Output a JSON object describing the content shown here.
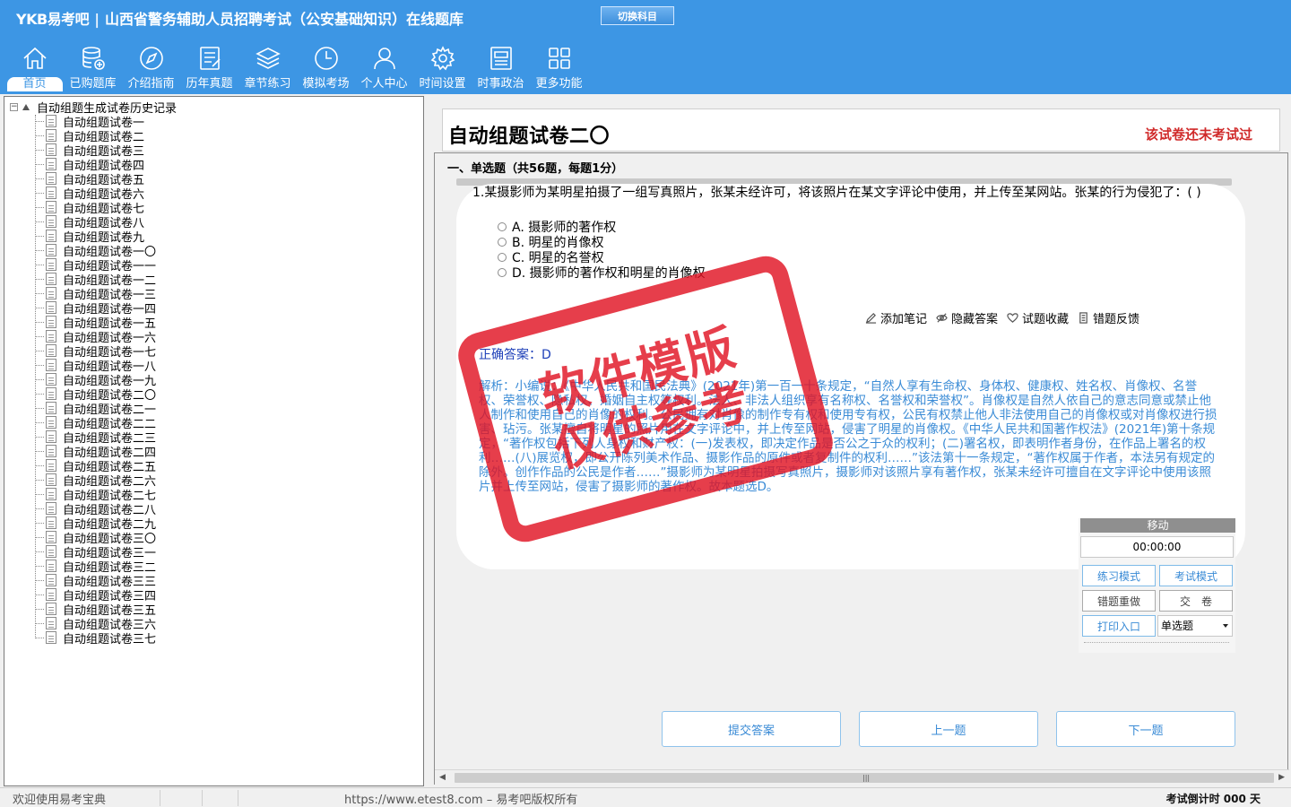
{
  "header": {
    "logo": "YKB易考吧",
    "title": "山西省警务辅助人员招聘考试（公安基础知识）在线题库",
    "switch_label": "切换科目",
    "toolbar": [
      {
        "label": "首页",
        "icon": "home-icon"
      },
      {
        "label": "已购题库",
        "icon": "database-icon"
      },
      {
        "label": "介绍指南",
        "icon": "compass-icon"
      },
      {
        "label": "历年真题",
        "icon": "document-list-icon"
      },
      {
        "label": "章节练习",
        "icon": "layers-icon"
      },
      {
        "label": "模拟考场",
        "icon": "clock-icon"
      },
      {
        "label": "个人中心",
        "icon": "user-icon"
      },
      {
        "label": "时间设置",
        "icon": "gear-icon"
      },
      {
        "label": "时事政治",
        "icon": "news-icon"
      },
      {
        "label": "更多功能",
        "icon": "grid-icon"
      }
    ]
  },
  "tree": {
    "root": "自动组题生成试卷历史记录",
    "items": [
      "自动组题试卷一",
      "自动组题试卷二",
      "自动组题试卷三",
      "自动组题试卷四",
      "自动组题试卷五",
      "自动组题试卷六",
      "自动组题试卷七",
      "自动组题试卷八",
      "自动组题试卷九",
      "自动组题试卷一〇",
      "自动组题试卷一一",
      "自动组题试卷一二",
      "自动组题试卷一三",
      "自动组题试卷一四",
      "自动组题试卷一五",
      "自动组题试卷一六",
      "自动组题试卷一七",
      "自动组题试卷一八",
      "自动组题试卷一九",
      "自动组题试卷二〇",
      "自动组题试卷二一",
      "自动组题试卷二二",
      "自动组题试卷二三",
      "自动组题试卷二四",
      "自动组题试卷二五",
      "自动组题试卷二六",
      "自动组题试卷二七",
      "自动组题试卷二八",
      "自动组题试卷二九",
      "自动组题试卷三〇",
      "自动组题试卷三一",
      "自动组题试卷三二",
      "自动组题试卷三三",
      "自动组题试卷三四",
      "自动组题试卷三五",
      "自动组题试卷三六",
      "自动组题试卷三七"
    ]
  },
  "exam": {
    "title": "自动组题试卷二〇",
    "status": "该试卷还未考试过",
    "section": "一、单选题（共56题，每题1分）",
    "question": "1.某摄影师为某明星拍摄了一组写真照片，张某未经许可，将该照片在某文字评论中使用，并上传至某网站。张某的行为侵犯了：( )",
    "options": [
      "A. 摄影师的著作权",
      "B. 明星的肖像权",
      "C. 明星的名誉权",
      "D. 摄影师的著作权和明星的肖像权"
    ],
    "actions": [
      {
        "label": "添加笔记",
        "icon": "pencil-icon"
      },
      {
        "label": "隐藏答案",
        "icon": "eye-icon"
      },
      {
        "label": "试题收藏",
        "icon": "heart-icon"
      },
      {
        "label": "错题反馈",
        "icon": "feedback-icon"
      }
    ],
    "answer": "正确答案：D",
    "analysis": "解析：小编说：《中华人民共和国民法典》(2021年)第一百一十条规定，“自然人享有生命权、身体权、健康权、姓名权、肖像权、名誉权、荣誉权、隐私权、婚姻自主权等权利。法人、非法人组织享有名称权、名誉权和荣誉权”。肖像权是自然人依自己的意志同意或禁止他人制作和使用自己的肖像的权利。公民拥有对肖像的制作专有权和使用专有权，公民有权禁止他人非法使用自己的肖像权或对肖像权进行损害、玷污。张某擅自将明星的照片用在文字评论中，并上传至网站，侵害了明星的肖像权。《中华人民共和国著作权法》(2021年)第十条规定，“著作权包括下列人身权和财产权：(一)发表权，即决定作品是否公之于众的权利；(二)署名权，即表明作者身份，在作品上署名的权利……(八)展览权，即公开陈列美术作品、摄影作品的原件或者复制件的权利……”该法第十一条规定，“著作权属于作者，本法另有规定的除外。创作作品的公民是作者……”摄影师为某明星拍摄写真照片，摄影师对该照片享有著作权，张某未经许可擅自在文字评论中使用该照片并上传至网站，侵害了摄影师的著作权。故本题选D。"
  },
  "timer": {
    "header": "移动",
    "time": "00:00:00",
    "practice_mode": "练习模式",
    "exam_mode": "考试模式",
    "redo_wrong": "错题重做",
    "submit_paper": "交　卷",
    "print": "打印入口",
    "type_select": "单选题"
  },
  "nav": {
    "submit": "提交答案",
    "prev": "上一题",
    "next": "下一题"
  },
  "watermark": {
    "line1": "软件模版",
    "line2": "仅供参考"
  },
  "statusbar": {
    "welcome": "欢迎使用易考宝典",
    "copyright": "https://www.etest8.com – 易考吧版权所有",
    "countdown": "考试倒计时 000 天"
  }
}
